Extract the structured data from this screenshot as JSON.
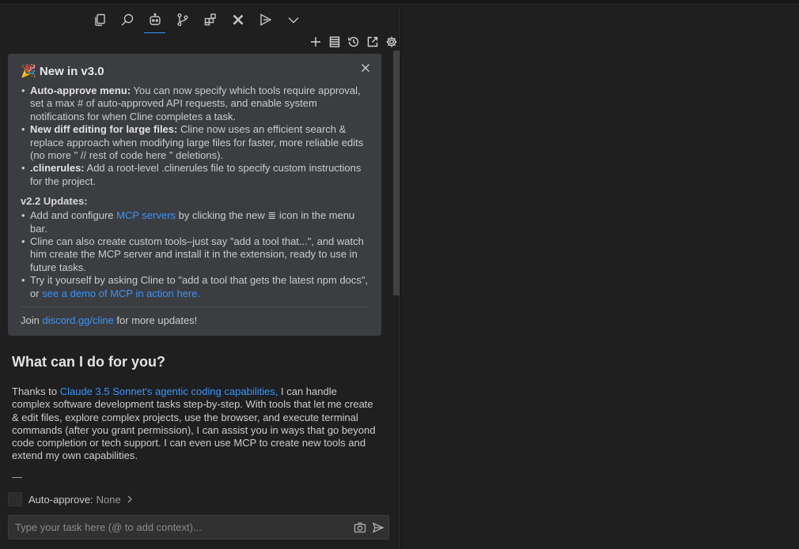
{
  "activity_bar": {
    "icons": [
      "explorer-icon",
      "search-icon",
      "cline-icon",
      "source-control-icon",
      "extensions-icon",
      "close-extension-icon",
      "run-debug-icon",
      "more-chevron-icon"
    ]
  },
  "toolbar": {
    "icons": [
      "new-task-icon",
      "mcp-servers-icon",
      "history-icon",
      "popout-icon",
      "settings-icon"
    ]
  },
  "announcement": {
    "emoji": "🎉",
    "title": "New in v3.0",
    "items": [
      {
        "bold": "Auto-approve menu:",
        "text": " You can now specify which tools require approval, set a max # of auto-approved API requests, and enable system notifications for when Cline completes a task."
      },
      {
        "bold": "New diff editing for large files:",
        "text": " Cline now uses an efficient search & replace approach when modifying large files for faster, more reliable edits (no more \" // rest of code here \" deletions)."
      },
      {
        "bold": ".clinerules:",
        "text": " Add a root-level  .clinerules  file to specify custom instructions for the project."
      }
    ],
    "subhead": "v2.2 Updates:",
    "updates": {
      "u1_pre": "Add and configure ",
      "u1_link": "MCP servers",
      "u1_post": " by clicking the new ≣ icon in the menu bar.",
      "u2": "Cline can also create custom tools–just say \"add a tool that...\", and watch him create the MCP server and install it in the extension, ready to use in future tasks.",
      "u3_pre": "Try it yourself by asking Cline to \"add a tool that gets the latest npm docs\", or ",
      "u3_link": "see a demo of MCP in action here."
    },
    "join_pre": "Join ",
    "join_link": "discord.gg/cline",
    "join_post": " for more updates!"
  },
  "welcome": {
    "title": "What can I do for you?",
    "text_pre": "Thanks to ",
    "text_link": "Claude 3.5 Sonnet's agentic coding capabilities,",
    "text_post": " I can handle complex software development tasks step-by-step. With tools that let me create & edit files, explore complex projects, use the browser, and execute terminal commands (after you grant permission), I can assist you in ways that go beyond code completion or tech support. I can even use MCP to create new tools and extend my own capabilities."
  },
  "auto_approve": {
    "label": "Auto-approve:",
    "value": "None"
  },
  "task_input": {
    "placeholder": "Type your task here (@ to add context)..."
  }
}
